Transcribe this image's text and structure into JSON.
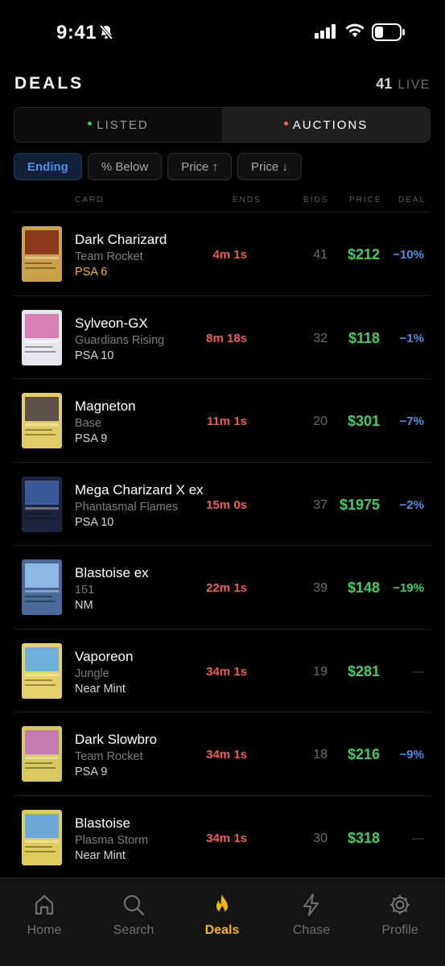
{
  "status_bar": {
    "time": "9:41"
  },
  "header": {
    "title": "DEALS",
    "live_count": "41",
    "live_label": "LIVE"
  },
  "segments": [
    {
      "label": "LISTED",
      "dot_color": "#3ecf62"
    },
    {
      "label": "AUCTIONS",
      "dot_color": "#ef5b5b"
    }
  ],
  "filters": [
    "Ending",
    "% Below",
    "Price ↑",
    "Price ↓"
  ],
  "columns": {
    "card": "CARD",
    "ends": "ENDS",
    "bids": "BIDS",
    "price": "PRICE",
    "deal": "DEAL"
  },
  "rows": [
    {
      "name": "Dark Charizard",
      "set": "Team Rocket",
      "grade": "PSA 6",
      "ends": "4m 1s",
      "bids": "41",
      "price": "$212",
      "deal": "−10%",
      "thumb_color": "#c9a24a"
    },
    {
      "name": "Sylveon-GX",
      "set": "Guardians Rising",
      "grade": "PSA 10",
      "ends": "8m 18s",
      "bids": "32",
      "price": "$118",
      "deal": "−1%",
      "thumb_color": "#d77fb0"
    },
    {
      "name": "Magneton",
      "set": "Base",
      "grade": "PSA 9",
      "ends": "11m 1s",
      "bids": "20",
      "price": "$301",
      "deal": "−7%",
      "thumb_color": "#d8c05a"
    },
    {
      "name": "Mega Charizard X ex",
      "set": "Phantasmal Flames",
      "grade": "PSA 10",
      "ends": "15m 0s",
      "bids": "37",
      "price": "$1975",
      "deal": "−2%",
      "thumb_color": "#3a4a7a"
    },
    {
      "name": "Blastoise ex",
      "set": "151",
      "grade": "NM",
      "ends": "22m 1s",
      "bids": "39",
      "price": "$148",
      "deal": "−19%",
      "thumb_color": "#5f8fc4"
    },
    {
      "name": "Vaporeon",
      "set": "Jungle",
      "grade": "Near Mint",
      "ends": "34m 1s",
      "bids": "19",
      "price": "$281",
      "deal": "—",
      "thumb_color": "#6fb0d8"
    },
    {
      "name": "Dark Slowbro",
      "set": "Team Rocket",
      "grade": "PSA 9",
      "ends": "34m 1s",
      "bids": "18",
      "price": "$216",
      "deal": "−9%",
      "thumb_color": "#c0d08a"
    },
    {
      "name": "Blastoise",
      "set": "Plasma Storm",
      "grade": "Near Mint",
      "ends": "34m 1s",
      "bids": "30",
      "price": "$318",
      "deal": "—",
      "thumb_color": "#6ea8da"
    }
  ],
  "tabs": [
    {
      "label": "Home",
      "icon": "home-icon"
    },
    {
      "label": "Search",
      "icon": "search-icon"
    },
    {
      "label": "Deals",
      "icon": "flame-icon"
    },
    {
      "label": "Chase",
      "icon": "bolt-icon"
    },
    {
      "label": "Profile",
      "icon": "gear-icon"
    }
  ],
  "colors": {
    "accent_gold": "#f5b800",
    "accent_blue": "#4d8fe6",
    "price_green": "#3ecf62",
    "ends_red": "#ef5b5b"
  }
}
